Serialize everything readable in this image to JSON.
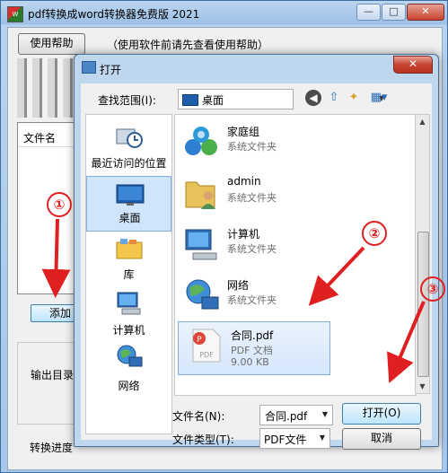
{
  "main": {
    "title": "pdf转换成word转换器免费版 2021",
    "buttons": {
      "minimize": "—",
      "maximize": "□",
      "close": "✕"
    },
    "help_button": "使用帮助",
    "help_note": "（使用软件前请先查看使用帮助）",
    "file_list_header": "文件名",
    "add_button": "添加",
    "output_dir_label": "输出目录",
    "progress_label": "转换进度"
  },
  "dialog": {
    "title": "打开",
    "close_glyph": "✕",
    "look_in_label": "查找范围(I):",
    "look_in_value": "桌面",
    "places": [
      {
        "label": "最近访问的位置",
        "icon": "recent-places-icon"
      },
      {
        "label": "桌面",
        "icon": "desktop-icon",
        "selected": true
      },
      {
        "label": "库",
        "icon": "libraries-icon"
      },
      {
        "label": "计算机",
        "icon": "computer-icon"
      },
      {
        "label": "网络",
        "icon": "network-icon"
      }
    ],
    "items": [
      {
        "name": "家庭组",
        "type": "系统文件夹",
        "icon": "homegroup-icon"
      },
      {
        "name": "admin",
        "type": "系统文件夹",
        "icon": "user-folder-icon"
      },
      {
        "name": "计算机",
        "type": "系统文件夹",
        "icon": "computer-icon"
      },
      {
        "name": "网络",
        "type": "系统文件夹",
        "icon": "network-icon"
      },
      {
        "name": "合同.pdf",
        "type": "PDF 文档",
        "size": "9.00 KB",
        "icon": "pdf-file-icon",
        "selected": true
      }
    ],
    "file_name_label": "文件名(N):",
    "file_name_value": "合同.pdf",
    "file_type_label": "文件类型(T):",
    "file_type_value": "PDF文件",
    "open_button": "打开(O)",
    "cancel_button": "取消",
    "annotations": [
      "①",
      "②",
      "③"
    ]
  },
  "colors": {
    "annotation": "#e02020",
    "selection": "#cfe5fb"
  }
}
